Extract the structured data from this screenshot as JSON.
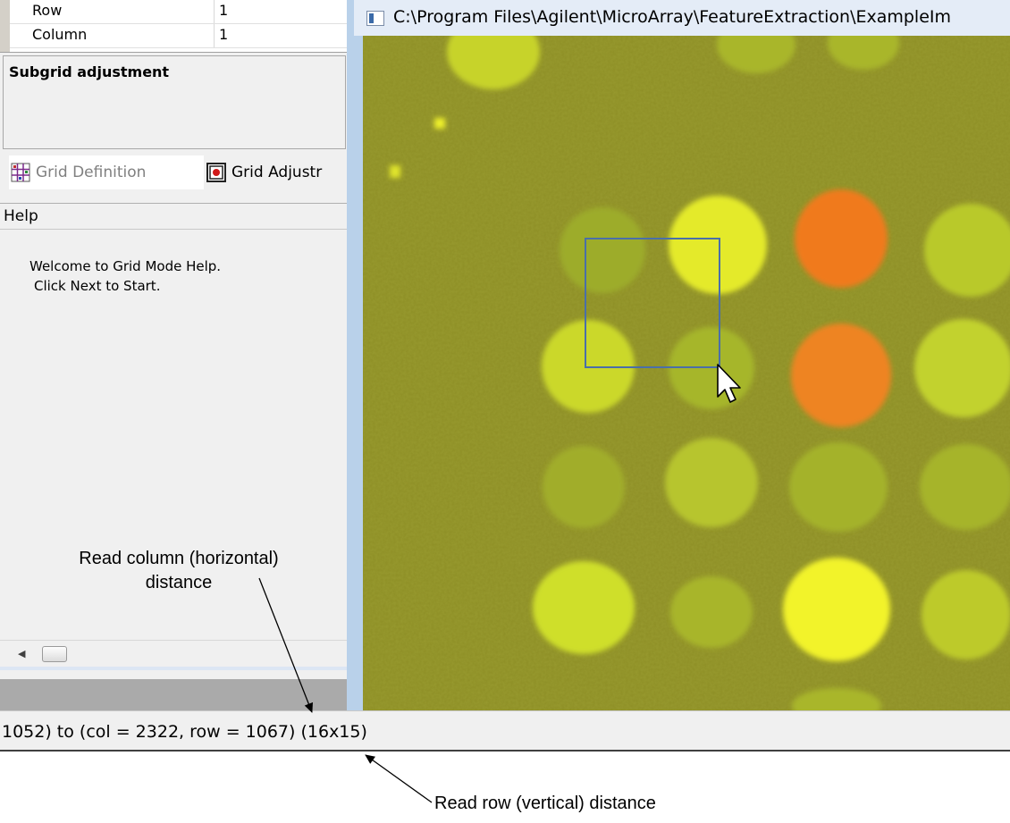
{
  "properties": {
    "rows": [
      {
        "name": "Row",
        "value": "1"
      },
      {
        "name": "Column",
        "value": "1"
      }
    ]
  },
  "subgrid_panel": {
    "title": "Subgrid adjustment"
  },
  "tabs": [
    {
      "label": "Grid Definition",
      "icon": "grid-definition-icon",
      "active": true
    },
    {
      "label": "Grid Adjustr",
      "icon": "grid-adjustment-icon",
      "active": false
    }
  ],
  "help": {
    "title": "Help",
    "lines": [
      "Welcome to Grid Mode Help.",
      "Click Next to Start."
    ]
  },
  "image_window": {
    "title": "C:\\Program Files\\Agilent\\MicroArray\\FeatureExtraction\\ExampleIm",
    "background_color": "#8e8f26",
    "spot_colors": {
      "green": "#b7c52e",
      "yellow": "#eaf02a",
      "orange": "#f07a1c",
      "dim": "#a9b62a"
    },
    "selection_color": "#4a6fa8"
  },
  "status_bar": {
    "text": "1052) to (col = 2322, row = 1067) (16x15)"
  },
  "annotations": {
    "column": [
      "Read column (horizontal)",
      "distance"
    ],
    "row": "Read row (vertical) distance"
  }
}
